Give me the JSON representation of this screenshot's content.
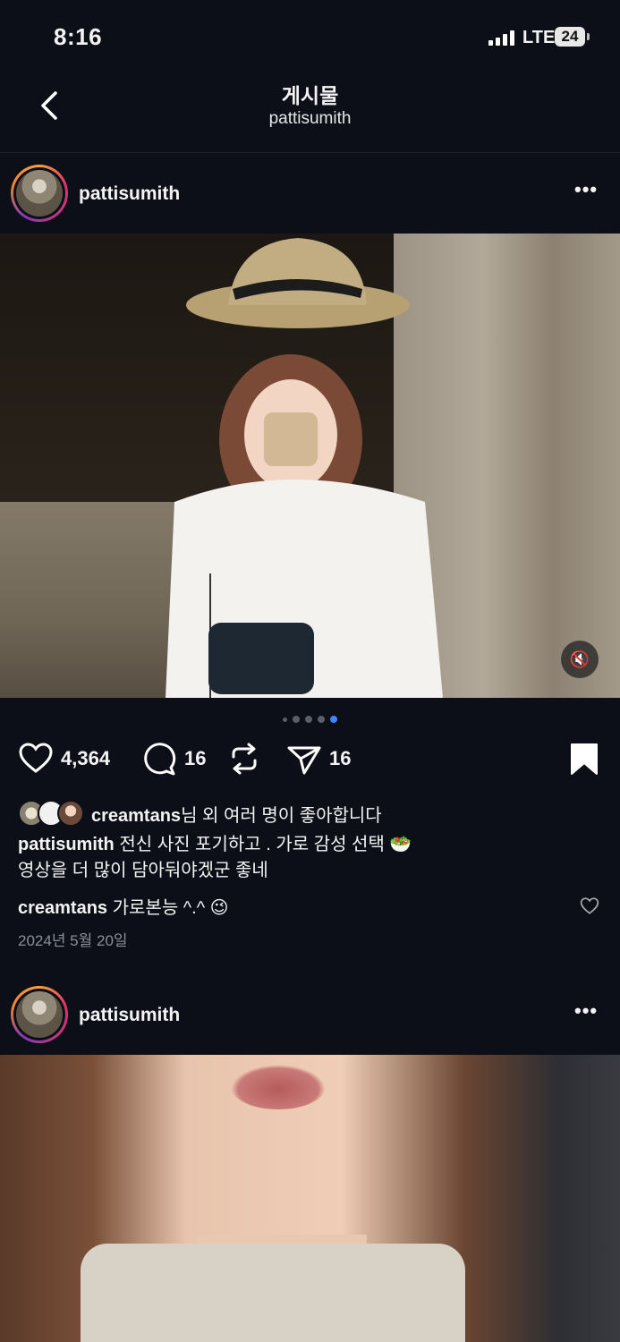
{
  "status_bar": {
    "time": "8:16",
    "network": "LTE",
    "battery": "24"
  },
  "header": {
    "title": "게시물",
    "subtitle": "pattisumith"
  },
  "post1": {
    "username": "pattisumith",
    "carousel": {
      "count": 5,
      "active_index": 3
    },
    "likes_count": "4,364",
    "comments_count": "16",
    "shares_count": "16",
    "liked_by": {
      "name": "creamtans",
      "suffix": "님 외 여러 명이 좋아합니다"
    },
    "caption": {
      "username": "pattisumith",
      "line1": "전신 사진 포기하고 . 가로 감성 선택 🥗",
      "line2": "영상을 더 많이 담아둬야겠군 좋네"
    },
    "comment": {
      "username": "creamtans",
      "text": "가로본능 ^.^ 😉"
    },
    "date": "2024년 5월 20일"
  },
  "post2": {
    "username": "pattisumith"
  },
  "icons": {
    "back": "chevron-left-icon",
    "like": "heart-outline-icon",
    "comment": "comment-bubble-icon",
    "repost": "repost-icon",
    "share": "paper-plane-icon",
    "save": "bookmark-filled-icon",
    "mute": "speaker-muted-icon"
  },
  "colors": {
    "background": "#0c0f18",
    "accent": "#3f86ff",
    "muted_text": "#8b8f99"
  }
}
